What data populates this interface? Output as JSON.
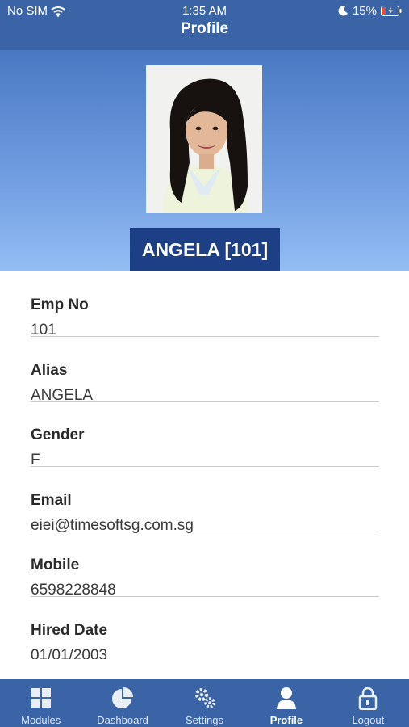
{
  "status_bar": {
    "carrier": "No SIM",
    "time": "1:35 AM",
    "battery": "15%",
    "icons": [
      "wifi-icon",
      "moon-icon",
      "battery-charging-icon"
    ]
  },
  "nav": {
    "title": "Profile"
  },
  "profile": {
    "display_name": "ANGELA [101]",
    "photo": "profile-photo"
  },
  "fields": [
    {
      "label": "Emp No",
      "value": "101"
    },
    {
      "label": "Alias",
      "value": "ANGELA"
    },
    {
      "label": "Gender",
      "value": "F"
    },
    {
      "label": "Email",
      "value": "eiei@timesoftsg.com.sg"
    },
    {
      "label": "Mobile",
      "value": "6598228848"
    },
    {
      "label": "Hired Date",
      "value": "01/01/2003"
    }
  ],
  "tabbar": {
    "items": [
      {
        "label": "Modules",
        "icon": "grid-icon"
      },
      {
        "label": "Dashboard",
        "icon": "pie-chart-icon"
      },
      {
        "label": "Settings",
        "icon": "gears-icon"
      },
      {
        "label": "Profile",
        "icon": "person-icon"
      },
      {
        "label": "Logout",
        "icon": "lock-icon"
      }
    ],
    "active": "Profile"
  },
  "colors": {
    "bar_blue": "#3b64a6",
    "badge_navy": "#1d3f86",
    "hero_top": "#4a79c3",
    "hero_bottom": "#93bdf3"
  }
}
